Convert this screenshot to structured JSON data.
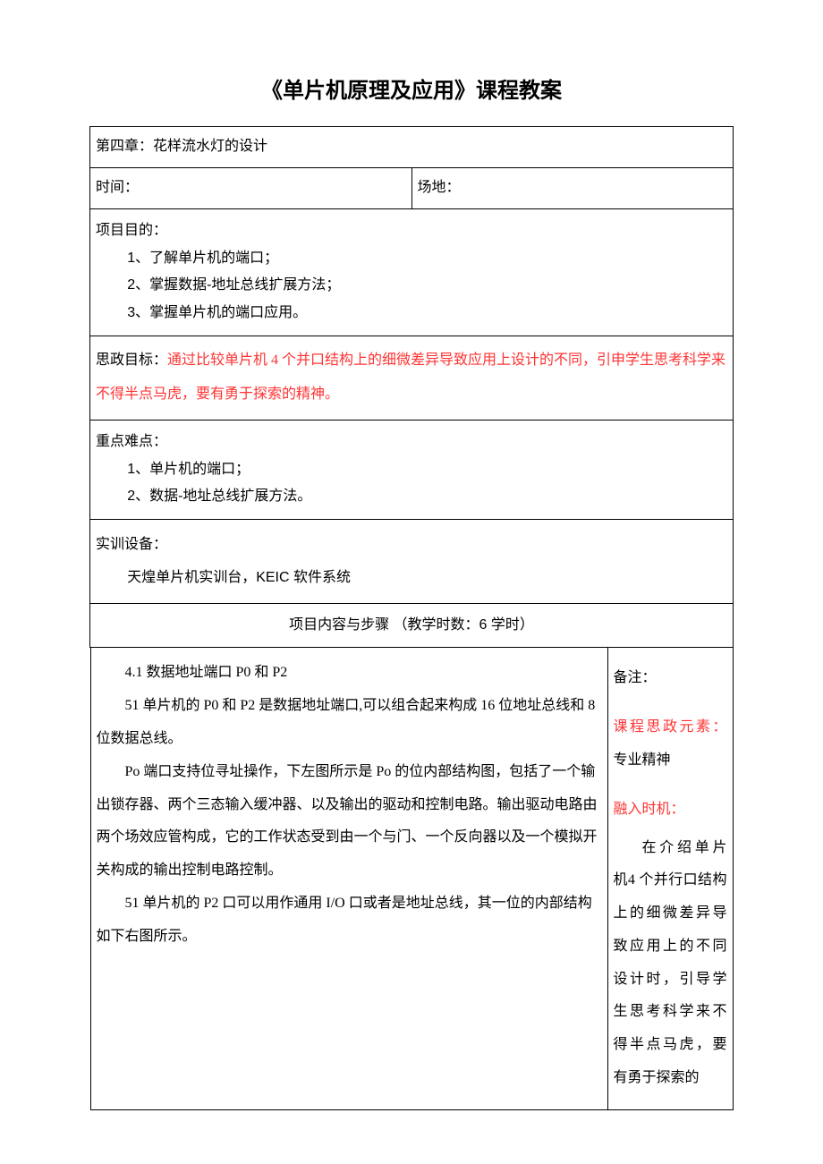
{
  "title": "《单片机原理及应用》课程教案",
  "chapter": "第四章：花样流水灯的设计",
  "time_label": "时间：",
  "place_label": "场地：",
  "objectives": {
    "heading": "项目目的：",
    "items": [
      "1、了解单片机的端口；",
      "2、掌握数据-地址总线扩展方法；",
      "3、掌握单片机的端口应用。"
    ]
  },
  "ideology": {
    "label": "思政目标：",
    "text": "通过比较单片机 4 个并口结构上的细微差异导致应用上设计的不同，引申学生思考科学来不得半点马虎，要有勇于探索的精神。"
  },
  "keypoints": {
    "heading": "重点难点：",
    "items": [
      "1、单片机的端口；",
      "2、数据-地址总线扩展方法。"
    ]
  },
  "equipment": {
    "heading": "实训设备：",
    "text": "天煌单片机实训台，KEIC 软件系统"
  },
  "steps_heading": "项目内容与步骤        （教学时数：6 学时）",
  "content": {
    "h41": "4.1 数据地址端口 P0 和 P2",
    "p1": "51 单片机的 P0 和 P2 是数据地址端口,可以组合起来构成 16 位地址总线和 8 位数据总线。",
    "p2": "Po 端口支持位寻址操作，下左图所示是 Po 的位内部结构图，包括了一个输出锁存器、两个三态输入缓冲器、以及输出的驱动和控制电路。输出驱动电路由两个场效应管构成，它的工作状态受到由一个与门、一个反向器以及一个模拟开关构成的输出控制电路控制。",
    "p3": "51 单片机的 P2 口可以用作通用 I/O 口或者是地址总线，其一位的内部结构如下右图所示。"
  },
  "notes": {
    "heading": "备注：",
    "element_label": "课程思政元素：",
    "element_value": "专业精神",
    "timing_label": "融入时机：",
    "timing_text": "在介绍单片机4 个并行口结构上的细微差异导致应用上的不同设计时，引导学生思考科学来不得半点马虎，要有勇于探索的"
  }
}
